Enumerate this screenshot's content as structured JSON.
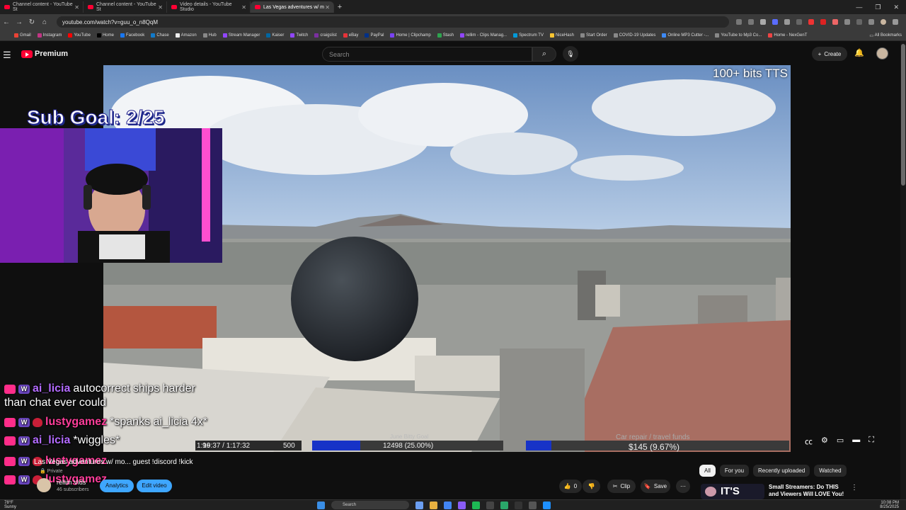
{
  "browser": {
    "tabs": [
      {
        "label": "Channel content - YouTube St"
      },
      {
        "label": "Channel content - YouTube St"
      },
      {
        "label": "Video details - YouTube Studio"
      },
      {
        "label": "Las Vegas adventures w/ m"
      }
    ],
    "url": "youtube.com/watch?v=guu_o_n8QqM",
    "bookmarks": [
      "Gmail",
      "Instagram",
      "YouTube",
      "Home",
      "Facebook",
      "Chase",
      "Amazon",
      "Hub",
      "Stream Manager",
      "Kaiser",
      "Twitch",
      "craigslist",
      "eBay",
      "PayPal",
      "Home | Clipchamp",
      "Stash",
      "rellim - Clips Manag...",
      "Spectrum TV",
      "NiceHash",
      "Start Order",
      "COVID-19 Updates",
      "Online MP3 Cutter -...",
      "YouTube to Mp3 Co...",
      "Home - NexGenT"
    ],
    "all_bookmarks": "All Bookmarks"
  },
  "youtube": {
    "logo_text": "Premium",
    "search_placeholder": "Search",
    "create_label": "Create"
  },
  "overlay": {
    "tts_text": "100+ bits TTS",
    "sub_goal": "Sub Goal: 2/25",
    "goals": [
      {
        "label": "",
        "left_value": "96",
        "right_value": "500"
      },
      {
        "label": "June Bitty Goal",
        "value": "12498 (25.00%)",
        "progress": 0.25
      },
      {
        "label": "Car repair / travel funds",
        "value": "$145 (9.67%)",
        "progress": 0.0967
      }
    ],
    "time": "1:19:37 / 1:17:32"
  },
  "chat": [
    {
      "user": "ai_licia",
      "user_color": "#b36bff",
      "message": "autocorrect ships harder"
    },
    {
      "user": "",
      "user_color": "#ffffff",
      "message": "than chat ever could"
    },
    {
      "user": "lustygamez",
      "user_color": "#ff3d9a",
      "message": "*spanks ai_licia 4x*"
    },
    {
      "user": "ai_licia",
      "user_color": "#b36bff",
      "message": "*wiggles*"
    },
    {
      "user": "lustygamez",
      "user_color": "#ff3d9a",
      "message": ""
    },
    {
      "user": "lustygamez",
      "user_color": "#ff3d9a",
      "message": ""
    }
  ],
  "video": {
    "title": "Las Vegas adventures w/ mo... guest !discord !kick",
    "privacy": "Private",
    "channel": "rellim Vids",
    "subscribers": "46 subscribers",
    "analytics_label": "Analytics",
    "edit_label": "Edit video",
    "likes": "0",
    "clip_label": "Clip",
    "save_label": "Save"
  },
  "sidebar": {
    "chips": [
      "All",
      "For you",
      "Recently uploaded",
      "Watched"
    ],
    "rec_title": "Small Streamers: Do THIS and Viewers Will LOVE You!",
    "rec_thumb_text": "IT'S"
  },
  "taskbar": {
    "temp": "78°F",
    "weather": "Sunny",
    "search": "Search",
    "time": "10:08 PM",
    "date": "8/25/2025"
  }
}
